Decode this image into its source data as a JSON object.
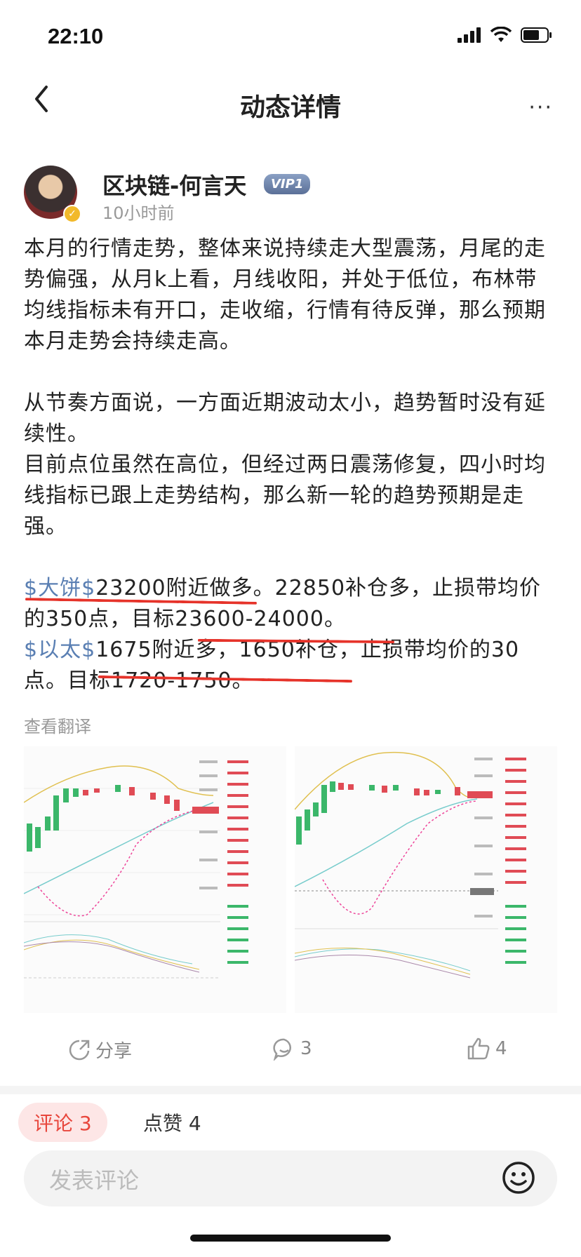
{
  "status": {
    "time": "22:10"
  },
  "nav": {
    "title": "动态详情",
    "more": "···"
  },
  "author": {
    "name": "区块链-何言天",
    "vip": "VIP1",
    "time": "10小时前"
  },
  "content": {
    "p1": "本月的行情走势，整体来说持续走大型震荡，月尾的走势偏强，从月k上看，月线收阳，并处于低位，布林带均线指标未有开口，走收缩，行情有待反弹，那么预期本月走势会持续走高。",
    "p2": "从节奏方面说，一方面近期波动太小，趋势暂时没有延续性。",
    "p3": "目前点位虽然在高位，但经过两日震荡修复，四小时均线指标已跟上走势结构，那么新一轮的趋势预期是走强。",
    "tag1": "$大饼$",
    "p4": "23200附近做多。22850补仓多，止损带均价的350点，目标23600-24000。",
    "tag2": "$以太$",
    "p5": "1675附近多，1650补仓，止损带均价的30点。目标1720-1750。"
  },
  "translate": "查看翻译",
  "actions": {
    "share": "分享",
    "comments": "3",
    "likes": "4"
  },
  "tabs": {
    "comments": "评论 3",
    "likes": "点赞 4"
  },
  "input": {
    "placeholder": "发表评论"
  },
  "colors": {
    "accent": "#e8463c",
    "tag": "#5a7fb3",
    "annotation": "#e6332a"
  },
  "icons": {
    "back": "chevron-left-icon",
    "share": "share-icon",
    "comment": "comment-icon",
    "like": "thumb-up-icon",
    "emoji": "emoji-icon"
  }
}
